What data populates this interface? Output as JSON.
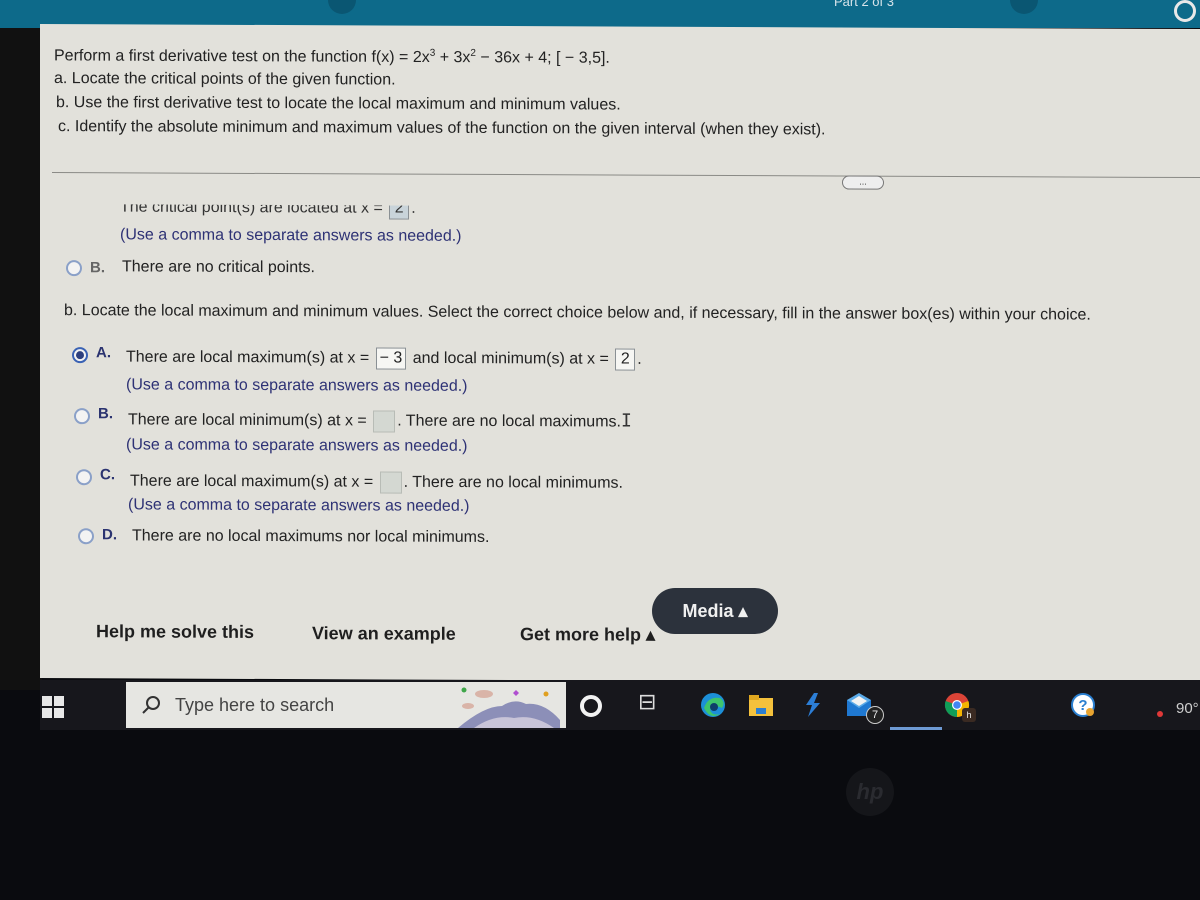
{
  "header": {
    "part_label": "Part 2 of 3"
  },
  "question": {
    "intro_prefix": "Perform a first derivative test on the function f(x) = 2x",
    "exp1": "3",
    "intro_mid": " + 3x",
    "exp2": "2",
    "intro_suffix": " − 36x + 4; [ − 3,5].",
    "part_a": "a. Locate the critical points of the given function.",
    "part_b": "b. Use the first derivative test to locate the local maximum and minimum values.",
    "part_c": "c. Identify the absolute minimum and maximum values of the function on the given interval (when they exist)."
  },
  "more_button": "...",
  "part_a_answer": {
    "partial_text": "The critical point(s) are located at x = ",
    "partial_value": "2",
    "hint": "(Use a comma to separate answers as needed.)",
    "option_b_letter": "B.",
    "option_b_text": "There are no critical points."
  },
  "part_b_section": {
    "instruction": "b. Locate the local maximum and minimum values. Select the correct choice below and, if necessary, fill in the answer box(es) within your choice.",
    "options": [
      {
        "letter": "A.",
        "selected": true,
        "text_1": "There are local maximum(s) at x = ",
        "value_1": "− 3",
        "text_2": " and local minimum(s) at x = ",
        "value_2": "2",
        "text_3": ".",
        "hint": "(Use a comma to separate answers as needed.)"
      },
      {
        "letter": "B.",
        "selected": false,
        "text_1": "There are local minimum(s) at x = ",
        "value_1": "",
        "text_2": ". There are no local maximums.",
        "hint": "(Use a comma to separate answers as needed.)"
      },
      {
        "letter": "C.",
        "selected": false,
        "text_1": "There are local maximum(s) at x = ",
        "value_1": "",
        "text_2": ". There are no local minimums.",
        "hint": "(Use a comma to separate answers as needed.)"
      },
      {
        "letter": "D.",
        "selected": false,
        "text_1": "There are no local maximums nor local minimums."
      }
    ]
  },
  "help_bar": {
    "help_me_solve": "Help me solve this",
    "view_example": "View an example",
    "get_more_help": "Get more help ▴",
    "media": "Media ▴"
  },
  "taskbar": {
    "search_placeholder": "Type here to search",
    "mail_badge": "7",
    "chrome_badge": "h",
    "weather_temp": "90°"
  },
  "bezel": {
    "logo": "hp"
  }
}
